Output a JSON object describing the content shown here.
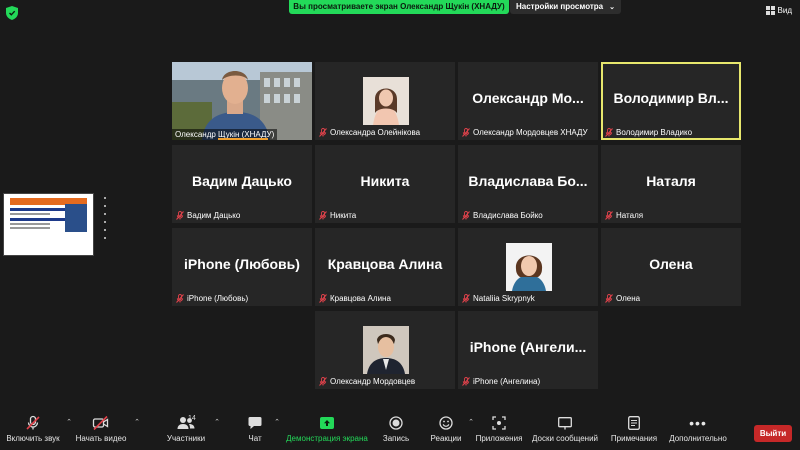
{
  "banner": {
    "sharing_text": "Вы просматриваете экран Олександр Щукін (ХНАДУ)",
    "view_settings_label": "Настройки просмотра",
    "view_button_label": "Вид"
  },
  "participants": [
    {
      "display": "video",
      "name": "Олександр Щукін (ХНАДУ)",
      "muted": false
    },
    {
      "display": "photo",
      "name": "Олександра Олейнікова",
      "muted": true
    },
    {
      "display": "text",
      "big_name": "Олександр Мо...",
      "name": "Олександр Мордовцев ХНАДУ",
      "muted": true
    },
    {
      "display": "text",
      "big_name": "Володимир Вл...",
      "name": "Володимир Владико",
      "muted": true,
      "active_speaker": true
    },
    {
      "display": "text",
      "big_name": "Вадим Дацько",
      "name": "Вадим Дацько",
      "muted": true
    },
    {
      "display": "text",
      "big_name": "Никита",
      "name": "Никита",
      "muted": true
    },
    {
      "display": "text",
      "big_name": "Владислава Бо...",
      "name": "Владислава Бойко",
      "muted": true
    },
    {
      "display": "text",
      "big_name": "Наталя",
      "name": "Наталя",
      "muted": true
    },
    {
      "display": "text",
      "big_name": "iPhone (Любовь)",
      "name": "iPhone (Любовь)",
      "muted": true
    },
    {
      "display": "text",
      "big_name": "Кравцова Алина",
      "name": "Кравцова Алина",
      "muted": true
    },
    {
      "display": "photo",
      "name": "Nataliia Skrypnyk",
      "muted": true
    },
    {
      "display": "text",
      "big_name": "Олена",
      "name": "Олена",
      "muted": true
    },
    {
      "display": "photo",
      "name": "Олександр Мордовцев",
      "muted": true
    },
    {
      "display": "text",
      "big_name": "iPhone (Ангели...",
      "name": "iPhone (Ангелина)",
      "muted": true
    }
  ],
  "toolbar": {
    "unmute": "Включить звук",
    "start_video": "Начать видео",
    "participants": "Участники",
    "participants_count": "14",
    "chat": "Чат",
    "share_screen": "Демонстрация экрана",
    "record": "Запись",
    "reactions": "Реакции",
    "apps": "Приложения",
    "whiteboards": "Доски сообщений",
    "notes": "Примечания",
    "more": "Дополнительно",
    "leave": "Выйти"
  },
  "colors": {
    "accent_green": "#23d959",
    "active_speaker": "#e7e76d",
    "leave_red": "#c62828",
    "muted_red": "#e0424b"
  }
}
